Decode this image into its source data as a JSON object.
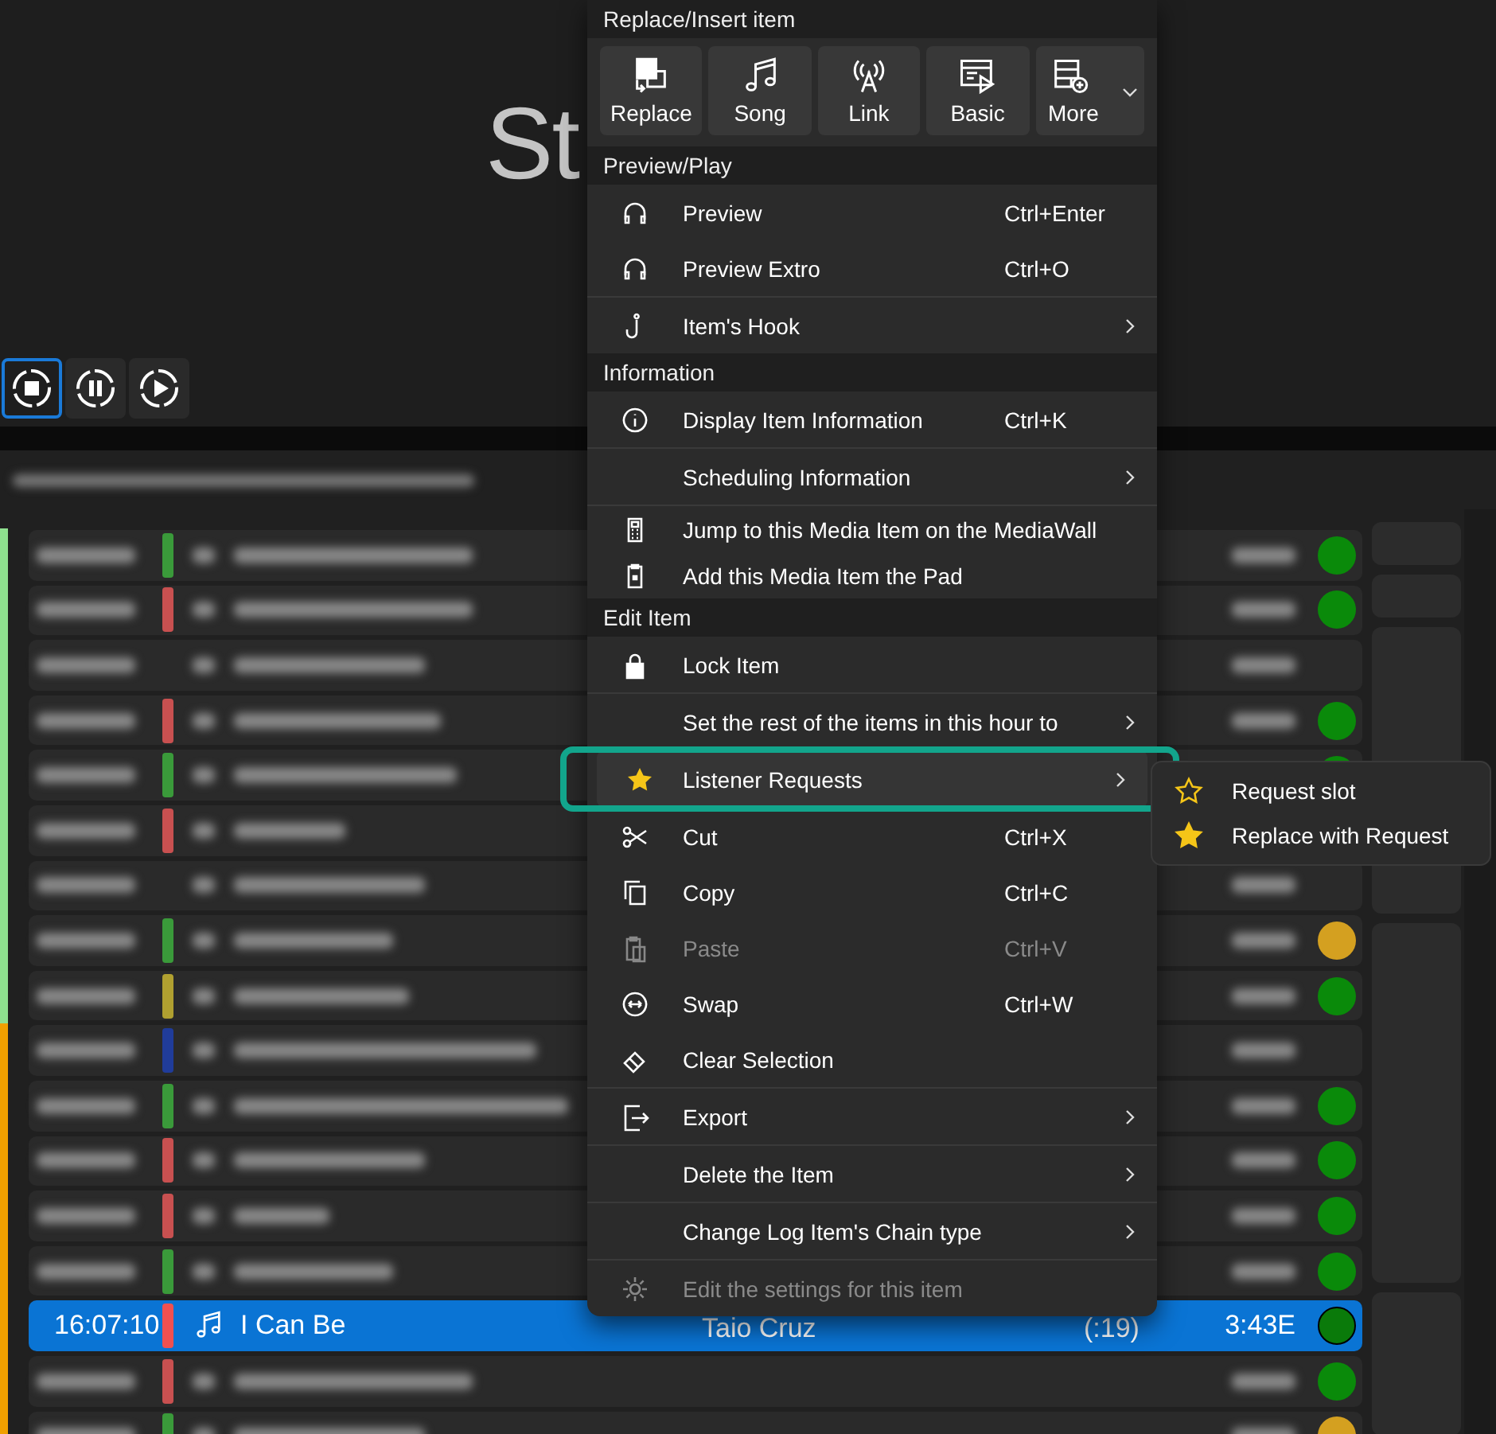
{
  "header": {
    "title_fragment": "St"
  },
  "transport": [
    {
      "kind": "stop",
      "selected": true
    },
    {
      "kind": "pause",
      "selected": false
    },
    {
      "kind": "play",
      "selected": false
    }
  ],
  "log_rows": [
    {
      "hour_marker": {
        "color": "#8fe08f"
      },
      "color": "#3a9a3a",
      "status_dot": {
        "color": "#0a8a0a"
      },
      "selected": false
    },
    {
      "hour_marker": {
        "color": "#8fe08f"
      },
      "color": "#c85050",
      "status_dot": {
        "color": "#0a8a0a"
      },
      "selected": false
    },
    {
      "hour_marker": {
        "color": "#8fe08f"
      },
      "selected": false
    },
    {
      "hour_marker": {
        "color": "#8fe08f"
      },
      "color": "#c85050",
      "status_dot": {
        "color": "#0a8a0a"
      },
      "selected": false
    },
    {
      "hour_marker": {
        "color": "#8fe08f"
      },
      "color": "#3a9a3a",
      "status_dot": {
        "color": "#0a8a0a"
      },
      "selected": false
    },
    {
      "hour_marker": {
        "color": "#8fe08f"
      },
      "color": "#c85050",
      "selected": false
    },
    {
      "hour_marker": {
        "color": "#8fe08f"
      },
      "selected": false
    },
    {
      "hour_marker": {
        "color": "#8fe08f"
      },
      "color": "#3a9a3a",
      "status_dot": {
        "color": "#d4a020"
      },
      "selected": false
    },
    {
      "hour_marker": {
        "color": "#8fe08f"
      },
      "color": "#b0a030",
      "status_dot": {
        "color": "#0a8a0a"
      },
      "selected": false
    },
    {
      "hour_marker": {
        "color": "#f0a000"
      },
      "color": "#203c9a",
      "selected": false
    },
    {
      "hour_marker": {
        "color": "#f0a000"
      },
      "color": "#3a9a3a",
      "status_dot": {
        "color": "#0a8a0a"
      },
      "selected": false
    },
    {
      "hour_marker": {
        "color": "#f0a000"
      },
      "color": "#c85050",
      "status_dot": {
        "color": "#0a8a0a"
      },
      "selected": false
    },
    {
      "hour_marker": {
        "color": "#f0a000"
      },
      "color": "#c85050",
      "status_dot": {
        "color": "#0a8a0a"
      },
      "selected": false
    },
    {
      "hour_marker": {
        "color": "#f0a000"
      },
      "color": "#3a9a3a",
      "status_dot": {
        "color": "#0a8a0a"
      },
      "selected": false
    },
    {
      "hour_marker": {
        "color": "#f0a000"
      },
      "color": "#f05050",
      "status_dot": {
        "color": "#0a7a0a"
      },
      "selected": true,
      "time": "16:07:10",
      "title": "I Can Be",
      "artist": "Taio Cruz",
      "intro": "(:19)",
      "duration": "3:43E"
    },
    {
      "hour_marker": {
        "color": "#f0a000"
      },
      "color": "#c85050",
      "status_dot": {
        "color": "#0a8a0a"
      },
      "selected": false
    },
    {
      "hour_marker": {
        "color": "#f0a000"
      },
      "color": "#3a9a3a",
      "status_dot": {
        "color": "#d4a020"
      },
      "selected": false
    }
  ],
  "context_menu": {
    "toolbar_header": "Replace/Insert item",
    "toolbar": [
      {
        "label": "Replace",
        "kind": "replace"
      },
      {
        "label": "Song",
        "kind": "song"
      },
      {
        "label": "Link",
        "kind": "link"
      },
      {
        "label": "Basic",
        "kind": "basic"
      },
      {
        "label": "More",
        "kind": "more",
        "dropdown": true
      }
    ],
    "sections": [
      {
        "header": "Preview/Play",
        "groups": [
          [
            {
              "label": "Preview",
              "shortcut": "Ctrl+Enter",
              "kind": "headphones"
            },
            {
              "label": "Preview Extro",
              "shortcut": "Ctrl+O",
              "kind": "headphones"
            }
          ],
          [
            {
              "label": "Item's Hook",
              "kind": "hook",
              "submenu": true
            }
          ]
        ]
      },
      {
        "header": "Information",
        "groups": [
          [
            {
              "label": "Display Item Information",
              "shortcut": "Ctrl+K",
              "kind": "info"
            }
          ],
          [
            {
              "label": "Scheduling Information",
              "submenu": true
            }
          ],
          [
            {
              "label": "Jump to this Media Item on the MediaWall",
              "kind": "calculator",
              "compact": true
            },
            {
              "label": "Add this Media Item the Pad",
              "kind": "clipboard",
              "compact": true
            }
          ]
        ]
      },
      {
        "header": "Edit Item",
        "groups": [
          [
            {
              "label": "Lock Item",
              "kind": "lock"
            }
          ],
          [
            {
              "label": "Set the rest of the items in this hour to",
              "submenu": true
            }
          ],
          [
            {
              "label": "Listener Requests",
              "kind": "star",
              "submenu": true,
              "highlighted": true,
              "annotated": true,
              "submenu_items": [
                {
                  "label": "Request slot",
                  "kind": "star-outline"
                },
                {
                  "label": "Replace with Request",
                  "kind": "star"
                }
              ]
            }
          ],
          [
            {
              "label": "Cut",
              "shortcut": "Ctrl+X",
              "kind": "scissors"
            },
            {
              "label": "Copy",
              "shortcut": "Ctrl+C",
              "kind": "copy"
            },
            {
              "label": "Paste",
              "shortcut": "Ctrl+V",
              "kind": "paste",
              "disabled": true
            },
            {
              "label": "Swap",
              "shortcut": "Ctrl+W",
              "kind": "swap"
            },
            {
              "label": "Clear Selection",
              "kind": "eraser"
            }
          ],
          [
            {
              "label": "Export",
              "kind": "export",
              "submenu": true
            }
          ],
          [
            {
              "label": "Delete the Item",
              "submenu": true
            }
          ],
          [
            {
              "label": "Change Log Item's Chain type",
              "submenu": true
            }
          ],
          [
            {
              "label": "Edit the settings for this item",
              "kind": "gear",
              "disabled": true
            }
          ]
        ]
      }
    ]
  }
}
